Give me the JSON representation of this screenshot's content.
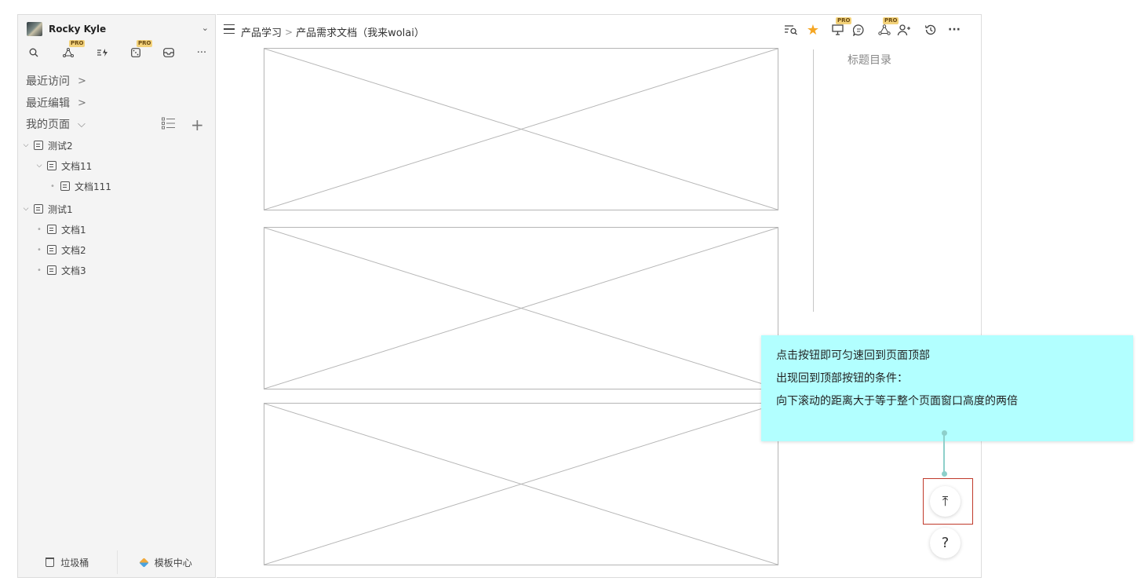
{
  "sidebar": {
    "workspace_name": "Rocky Kyle",
    "toolbar_icons": [
      "search-icon",
      "graph-icon",
      "quick-capture-icon",
      "dice-icon",
      "inbox-icon",
      "more-icon"
    ],
    "pro_badge": "PRO",
    "sections": {
      "recent_visits": "最近访问",
      "recent_edits": "最近编辑",
      "my_pages": "我的页面"
    },
    "tree": [
      {
        "label": "测试2"
      },
      {
        "label": "文档11"
      },
      {
        "label": "文档111"
      },
      {
        "label": "测试1"
      },
      {
        "label": "文档1"
      },
      {
        "label": "文档2"
      },
      {
        "label": "文档3"
      }
    ],
    "footer": {
      "trash": "垃圾桶",
      "templates": "模板中心"
    }
  },
  "header": {
    "breadcrumb": [
      "产品学习",
      "产品需求文档（我来wolai）"
    ],
    "icons": [
      "search-in-page-icon",
      "star-icon",
      "present-icon",
      "comment-icon",
      "graph-icon",
      "share-user-icon",
      "history-icon",
      "more-icon"
    ],
    "pro_badge": "PRO"
  },
  "toc": {
    "title": "标题目录"
  },
  "floating": {
    "back_to_top": "⤒",
    "help": "?"
  },
  "annotation": {
    "lines": [
      "点击按钮即可匀速回到页面顶部",
      "出现回到顶部按钮的条件：",
      "向下滚动的距离大于等于整个页面窗口高度的两倍"
    ]
  },
  "colors": {
    "annotation_bg": "#b2ffff",
    "star": "#f5a623",
    "highlight_frame": "#c0392b",
    "connector": "#8ecfca"
  }
}
